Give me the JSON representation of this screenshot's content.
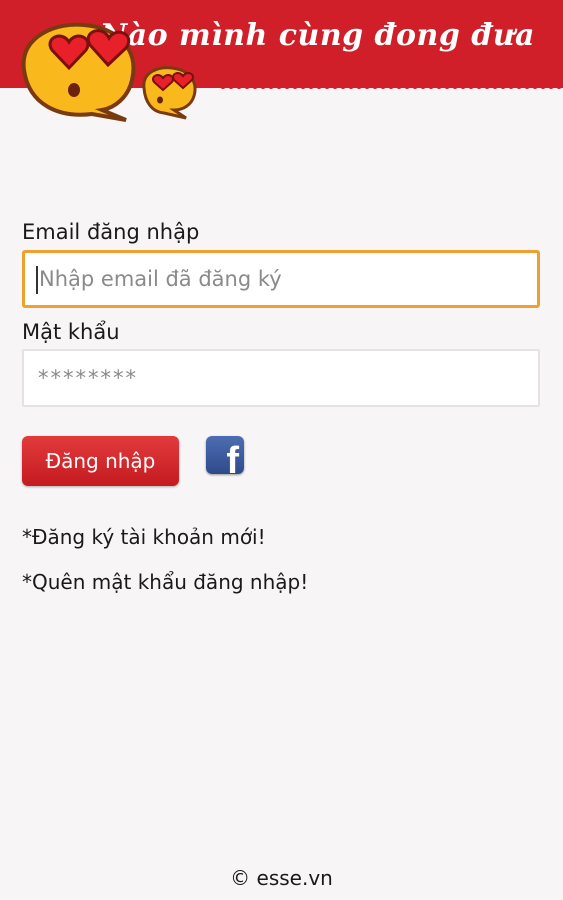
{
  "header": {
    "title": "Nào mình cùng đong đưa",
    "background_color": "#d11f2a",
    "mascot_icon": "heart-eyes-chat-bubbles"
  },
  "form": {
    "email_label": "Email đăng nhập",
    "email_placeholder": "Nhập email đã đăng ký",
    "email_value": "",
    "password_label": "Mật khẩu",
    "password_value": "********",
    "login_button": "Đăng nhập",
    "facebook_icon": "facebook-icon",
    "facebook_glyph": "f"
  },
  "links": {
    "register": "*Đăng ký tài khoản mới!",
    "forgot_password": "*Quên mật khẩu đăng nhập!"
  },
  "footer": {
    "text": "© esse.vn"
  },
  "colors": {
    "accent_focus": "#f0a030",
    "button_red": "#d11f2a",
    "facebook_blue": "#3b5998"
  }
}
